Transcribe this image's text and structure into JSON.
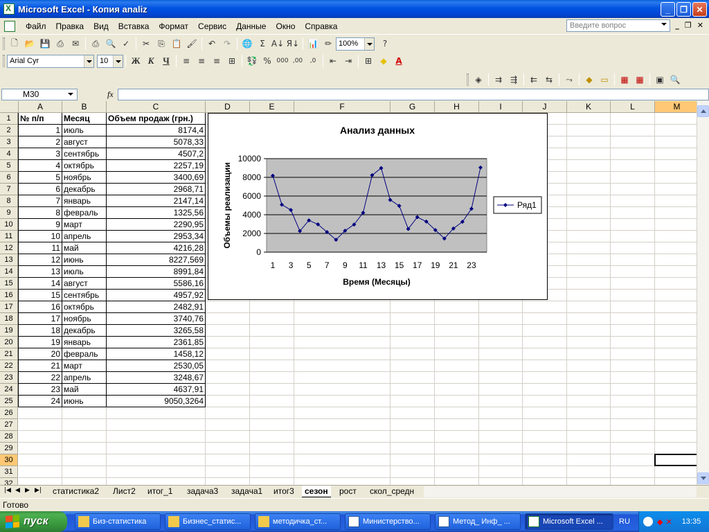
{
  "window": {
    "title": "Microsoft Excel - Копия analiz"
  },
  "menu": {
    "items": [
      "Файл",
      "Правка",
      "Вид",
      "Вставка",
      "Формат",
      "Сервис",
      "Данные",
      "Окно",
      "Справка"
    ],
    "ask_placeholder": "Введите вопрос"
  },
  "toolbar": {
    "zoom": "100%",
    "font_name": "Arial Cyr",
    "font_size": "10",
    "bold": "Ж",
    "italic": "К",
    "underline": "Ч",
    "percent": "%",
    "thousands": "000",
    "sum": "Σ"
  },
  "formula_bar": {
    "name_box": "M30",
    "fx": "fx",
    "value": ""
  },
  "columns": [
    "A",
    "B",
    "C",
    "D",
    "E",
    "F",
    "G",
    "H",
    "I",
    "J",
    "K",
    "L",
    "M"
  ],
  "selected_column": "M",
  "selected_row": 30,
  "rows": [
    "1",
    "2",
    "3",
    "4",
    "5",
    "6",
    "7",
    "8",
    "9",
    "10",
    "11",
    "12",
    "13",
    "14",
    "15",
    "16",
    "17",
    "18",
    "19",
    "20",
    "21",
    "22",
    "23",
    "24",
    "25",
    "26",
    "27",
    "28",
    "29",
    "30",
    "31",
    "32"
  ],
  "table": {
    "headers": [
      "№ п/п",
      "Месяц",
      "Объем продаж (грн.)"
    ],
    "rows": [
      [
        "1",
        "июль",
        "8174,4"
      ],
      [
        "2",
        "август",
        "5078,33"
      ],
      [
        "3",
        "сентябрь",
        "4507,2"
      ],
      [
        "4",
        "октябрь",
        "2257,19"
      ],
      [
        "5",
        "ноябрь",
        "3400,69"
      ],
      [
        "6",
        "декабрь",
        "2968,71"
      ],
      [
        "7",
        "январь",
        "2147,14"
      ],
      [
        "8",
        "февраль",
        "1325,56"
      ],
      [
        "9",
        "март",
        "2290,95"
      ],
      [
        "10",
        "апрель",
        "2953,34"
      ],
      [
        "11",
        "май",
        "4216,28"
      ],
      [
        "12",
        "июнь",
        "8227,569"
      ],
      [
        "13",
        "июль",
        "8991,84"
      ],
      [
        "14",
        "август",
        "5586,16"
      ],
      [
        "15",
        "сентябрь",
        "4957,92"
      ],
      [
        "16",
        "октябрь",
        "2482,91"
      ],
      [
        "17",
        "ноябрь",
        "3740,76"
      ],
      [
        "18",
        "декабрь",
        "3265,58"
      ],
      [
        "19",
        "январь",
        "2361,85"
      ],
      [
        "20",
        "февраль",
        "1458,12"
      ],
      [
        "21",
        "март",
        "2530,05"
      ],
      [
        "22",
        "апрель",
        "3248,67"
      ],
      [
        "23",
        "май",
        "4637,91"
      ],
      [
        "24",
        "июнь",
        "9050,3264"
      ]
    ]
  },
  "chart_data": {
    "type": "line",
    "title": "Анализ данных",
    "xlabel": "Время (Месяцы)",
    "ylabel": "Объемы реализации",
    "x": [
      1,
      2,
      3,
      4,
      5,
      6,
      7,
      8,
      9,
      10,
      11,
      12,
      13,
      14,
      15,
      16,
      17,
      18,
      19,
      20,
      21,
      22,
      23,
      24
    ],
    "x_tick_labels": [
      "1",
      "3",
      "5",
      "7",
      "9",
      "11",
      "13",
      "15",
      "17",
      "19",
      "21",
      "23"
    ],
    "y_tick_labels": [
      "10000",
      "8000",
      "6000",
      "4000",
      "2000",
      "0"
    ],
    "ylim": [
      0,
      10000
    ],
    "grid": true,
    "legend": "right",
    "series": [
      {
        "name": "Ряд1",
        "color": "#000080",
        "values": [
          8174.4,
          5078.33,
          4507.2,
          2257.19,
          3400.69,
          2968.71,
          2147.14,
          1325.56,
          2290.95,
          2953.34,
          4216.28,
          8227.569,
          8991.84,
          5586.16,
          4957.92,
          2482.91,
          3740.76,
          3265.58,
          2361.85,
          1458.12,
          2530.05,
          3248.67,
          4637.91,
          9050.3264
        ]
      }
    ],
    "plot_background": "#C0C0C0"
  },
  "sheet_tabs": [
    "статистика2",
    "Лист2",
    "итог_1",
    "задача3",
    "задача1",
    "итог3",
    "сезон",
    "рост",
    "скол_средн"
  ],
  "active_tab": "сезон",
  "status": "Готово",
  "taskbar": {
    "start": "пуск",
    "items": [
      "Биз-статистика",
      "Бизнес_статис...",
      "методичка_ст...",
      "Министерство...",
      "Метод_ Инф_ ...",
      "Microsoft Excel ..."
    ],
    "lang": "RU",
    "time": "13:35"
  },
  "colors": {
    "title_bar": "#0053E1",
    "selected_header": "#FFC875",
    "taskbar": "#2663E0",
    "start_button": "#3A9A3E"
  }
}
